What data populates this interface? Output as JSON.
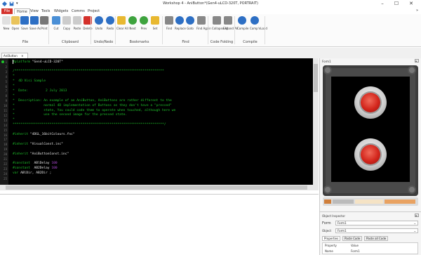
{
  "window": {
    "title": "Workshop 4 - AniButton*(Gen4-uLCD-320T, PORTRAIT)",
    "minimize": "–",
    "maximize": "☐",
    "close": "✕"
  },
  "menu": {
    "file": "File",
    "items": [
      "Home",
      "View",
      "Tools",
      "Widgets",
      "Comms",
      "Project"
    ]
  },
  "ribbon": {
    "buttons": [
      {
        "label": "New",
        "icon": "new-icon",
        "color": "#e0e0e0"
      },
      {
        "label": "Open",
        "icon": "open-folder-icon",
        "color": "#e9c35a"
      },
      {
        "label": "Save",
        "icon": "save-icon",
        "color": "#2d6fc4"
      },
      {
        "label": "Save As",
        "icon": "save-as-icon",
        "color": "#2d6fc4"
      },
      {
        "label": "Print",
        "icon": "print-icon",
        "color": "#777777"
      },
      {
        "label": "Cut",
        "icon": "cut-icon",
        "color": "#4a8fd6"
      },
      {
        "label": "Copy",
        "icon": "copy-icon",
        "color": "#cccccc"
      },
      {
        "label": "Paste",
        "icon": "paste-icon",
        "color": "#cccccc"
      },
      {
        "label": "Delete",
        "icon": "delete-icon",
        "color": "#d4312b"
      },
      {
        "label": "Undo",
        "icon": "undo-icon",
        "color": "#2d6fc4"
      },
      {
        "label": "Redo",
        "icon": "redo-icon",
        "color": "#2d6fc4"
      },
      {
        "label": "Clear All",
        "icon": "clear-all-icon",
        "color": "#e8b830"
      },
      {
        "label": "Next",
        "icon": "next-icon",
        "color": "#3ea33e"
      },
      {
        "label": "Prev",
        "icon": "prev-icon",
        "color": "#3ea33e"
      },
      {
        "label": "Set",
        "icon": "set-bookmark-icon",
        "color": "#e8b830"
      },
      {
        "label": "Find",
        "icon": "find-icon",
        "color": "#888888"
      },
      {
        "label": "Replace",
        "icon": "replace-icon",
        "color": "#2d6fc4"
      },
      {
        "label": "Goto",
        "icon": "goto-icon",
        "color": "#2d6fc4"
      },
      {
        "label": "Find Again",
        "icon": "find-again-icon",
        "color": "#888888"
      },
      {
        "label": "Collapse All",
        "icon": "collapse-all-icon",
        "color": "#888888"
      },
      {
        "label": "Expand All",
        "icon": "expand-all-icon",
        "color": "#888888"
      },
      {
        "label": "Compile",
        "icon": "compile-icon",
        "color": "#2d6fc4"
      },
      {
        "label": "Comp'nLoad",
        "icon": "compile-load-icon",
        "color": "#2d6fc4"
      }
    ],
    "groups": [
      "File",
      "Clipboard",
      "Undo/Redo",
      "Bookmarks",
      "Find",
      "Code Folding",
      "Compile"
    ]
  },
  "editor": {
    "tab_label": "AniButton",
    "tab_close": "✕",
    "line_numbers": [
      "1",
      "2",
      "3",
      "4",
      "5",
      "6",
      "7",
      "8",
      "9",
      "10",
      "11",
      "12",
      "13",
      "14",
      "15",
      "16",
      "17",
      "18",
      "19",
      "20",
      "21",
      "22",
      "23",
      "24",
      "25"
    ],
    "lines": [
      {
        "parts": [
          {
            "t": "#platform ",
            "c": "c-green"
          },
          {
            "t": "\"Gen4-uLCD-320T\"",
            "c": "c-white"
          }
        ]
      },
      {
        "parts": []
      },
      {
        "parts": [
          {
            "t": "/*****************************************************************************",
            "c": "c-green"
          }
        ]
      },
      {
        "parts": [
          {
            "t": "*",
            "c": "c-green"
          }
        ]
      },
      {
        "parts": [
          {
            "t": "*  4D Visi Sample",
            "c": "c-green"
          }
        ]
      },
      {
        "parts": [
          {
            "t": "*",
            "c": "c-green"
          }
        ]
      },
      {
        "parts": [
          {
            "t": "*  Date:         2 July 2013",
            "c": "c-green"
          }
        ]
      },
      {
        "parts": [
          {
            "t": "*",
            "c": "c-green"
          }
        ]
      },
      {
        "parts": [
          {
            "t": "*  Description: An example of an AniButton, AniButtons are rather different to the",
            "c": "c-green"
          }
        ]
      },
      {
        "parts": [
          {
            "t": "*               normal 4D implementation of Buttons as they don't have a \"pressed\"",
            "c": "c-green"
          }
        ]
      },
      {
        "parts": [
          {
            "t": "*               state, You could code them to operate when touched, although here we",
            "c": "c-green"
          }
        ]
      },
      {
        "parts": [
          {
            "t": "*               use the second image for the pressed state.",
            "c": "c-green"
          }
        ]
      },
      {
        "parts": [
          {
            "t": "*",
            "c": "c-green"
          }
        ]
      },
      {
        "parts": [
          {
            "t": "******************************************************************************/",
            "c": "c-green"
          }
        ]
      },
      {
        "parts": []
      },
      {
        "parts": [
          {
            "t": "#inherit ",
            "c": "c-green"
          },
          {
            "t": "\"4DGL_16bitColours.fnc\"",
            "c": "c-white"
          }
        ]
      },
      {
        "parts": []
      },
      {
        "parts": [
          {
            "t": "#inherit ",
            "c": "c-green"
          },
          {
            "t": "\"VisualConst.inc\"",
            "c": "c-white"
          }
        ]
      },
      {
        "parts": []
      },
      {
        "parts": [
          {
            "t": "#inherit ",
            "c": "c-green"
          },
          {
            "t": "\"AniButtonConst.inc\"",
            "c": "c-white"
          }
        ]
      },
      {
        "parts": []
      },
      {
        "parts": [
          {
            "t": "#constant  ",
            "c": "c-green"
          },
          {
            "t": "ABlDelay ",
            "c": "c-white"
          },
          {
            "t": "100",
            "c": "c-purple"
          }
        ]
      },
      {
        "parts": [
          {
            "t": "#constant  ",
            "c": "c-green"
          },
          {
            "t": "AB2Delay ",
            "c": "c-white"
          },
          {
            "t": "100",
            "c": "c-purple"
          }
        ]
      },
      {
        "parts": [
          {
            "t": "var ",
            "c": "c-green"
          },
          {
            "t": "ABlDir, AB2Dir ;",
            "c": "c-white"
          }
        ]
      },
      {
        "parts": []
      }
    ]
  },
  "form_pane": {
    "title": "Form1",
    "pin": "⊞"
  },
  "inspector": {
    "title": "Object Inspector",
    "form_label": "Form",
    "form_value": "Form1",
    "object_label": "Object",
    "object_value": "Form1",
    "tabs": [
      "Properties",
      "Paste Code",
      "Paste all Code"
    ],
    "col_property": "Property",
    "col_value": "Value",
    "row_name": "Name",
    "row_name_value": "Form1"
  }
}
